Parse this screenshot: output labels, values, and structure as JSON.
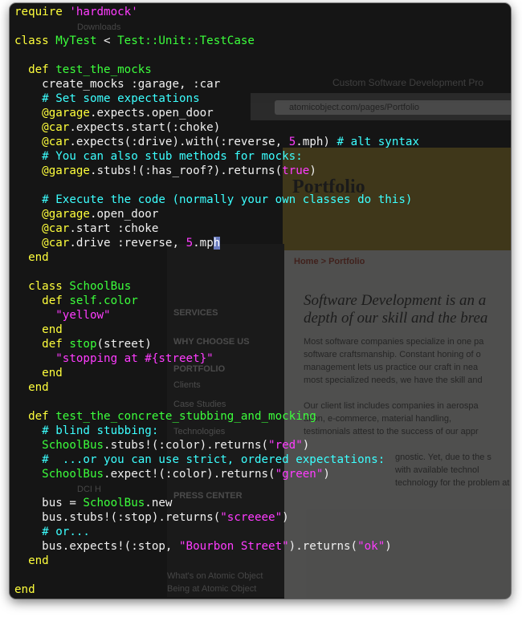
{
  "background_window": {
    "title": "Custom Software Development Pro",
    "url": "atomicobject.com/pages/Portfolio",
    "page_heading": "Portfolio",
    "breadcrumb": "Home > Portfolio",
    "tagline_1": "Software Development is an a",
    "tagline_2": "depth of our skill and the brea",
    "nav": [
      "SERVICES",
      "WHY CHOOSE US",
      "PORTFOLIO",
      "Clients",
      "Case Studies",
      "Technologies",
      "PRESS CENTER"
    ],
    "paragraph_1": [
      "Most software companies specialize in one pa",
      "software craftsmanship. Constant honing of o",
      "management lets us practice our craft in nea",
      "most specialized needs, we have the skill and"
    ],
    "paragraph_2": [
      "Our client list includes companies in aerospa",
      "ation, e-commerce, material handling,",
      "testimonials attest to the success of our appr"
    ],
    "paragraph_3": [
      "gnostic. Yet, due to the s",
      "with available technol",
      "technology for the problem at hand"
    ],
    "side_items": [
      "Downloads",
      "DCI H",
      "What's on Atomic Object",
      "Being at Atomic Object"
    ]
  },
  "code_lines": [
    [
      [
        "kw",
        "require"
      ],
      [
        "plain",
        " "
      ],
      [
        "str",
        "'hardmock'"
      ]
    ],
    [],
    [
      [
        "kw",
        "class"
      ],
      [
        "plain",
        " "
      ],
      [
        "name",
        "MyTest"
      ],
      [
        "plain",
        " < "
      ],
      [
        "const",
        "Test::Unit::TestCase"
      ]
    ],
    [],
    [
      [
        "plain",
        "  "
      ],
      [
        "kw",
        "def"
      ],
      [
        "plain",
        " "
      ],
      [
        "name",
        "test_the_mocks"
      ]
    ],
    [
      [
        "plain",
        "    create_mocks :garage, :car"
      ]
    ],
    [
      [
        "plain",
        "    "
      ],
      [
        "com",
        "# Set some expectations"
      ]
    ],
    [
      [
        "plain",
        "    "
      ],
      [
        "ivar",
        "@garage"
      ],
      [
        "plain",
        ".expects.open_door"
      ]
    ],
    [
      [
        "plain",
        "    "
      ],
      [
        "ivar",
        "@car"
      ],
      [
        "plain",
        ".expects.start(:choke)"
      ]
    ],
    [
      [
        "plain",
        "    "
      ],
      [
        "ivar",
        "@car"
      ],
      [
        "plain",
        ".expects(:drive).with(:reverse, "
      ],
      [
        "num",
        "5"
      ],
      [
        "plain",
        ".mph) "
      ],
      [
        "com",
        "# alt syntax"
      ]
    ],
    [
      [
        "plain",
        "    "
      ],
      [
        "com",
        "# You can also stub methods for mocks:"
      ]
    ],
    [
      [
        "plain",
        "    "
      ],
      [
        "ivar",
        "@garage"
      ],
      [
        "plain",
        ".stubs!(:has_roof?).returns("
      ],
      [
        "str",
        "true"
      ],
      [
        "plain",
        ")"
      ]
    ],
    [],
    [
      [
        "plain",
        "    "
      ],
      [
        "com",
        "# Execute the code (normally your own classes do this)"
      ]
    ],
    [
      [
        "plain",
        "    "
      ],
      [
        "ivar",
        "@garage"
      ],
      [
        "plain",
        ".open_door"
      ]
    ],
    [
      [
        "plain",
        "    "
      ],
      [
        "ivar",
        "@car"
      ],
      [
        "plain",
        ".start :choke"
      ]
    ],
    [
      [
        "plain",
        "    "
      ],
      [
        "ivar",
        "@car"
      ],
      [
        "plain",
        ".drive :reverse, "
      ],
      [
        "num",
        "5"
      ],
      [
        "plain",
        ".mp"
      ],
      [
        "cursor",
        "h"
      ]
    ],
    [
      [
        "plain",
        "  "
      ],
      [
        "kw",
        "end"
      ]
    ],
    [],
    [
      [
        "plain",
        "  "
      ],
      [
        "kw",
        "class"
      ],
      [
        "plain",
        " "
      ],
      [
        "name",
        "SchoolBus"
      ]
    ],
    [
      [
        "plain",
        "    "
      ],
      [
        "kw",
        "def"
      ],
      [
        "plain",
        " "
      ],
      [
        "name",
        "self.color"
      ]
    ],
    [
      [
        "plain",
        "      "
      ],
      [
        "str",
        "\"yellow\""
      ]
    ],
    [
      [
        "plain",
        "    "
      ],
      [
        "kw",
        "end"
      ]
    ],
    [
      [
        "plain",
        "    "
      ],
      [
        "kw",
        "def"
      ],
      [
        "plain",
        " "
      ],
      [
        "name",
        "stop"
      ],
      [
        "plain",
        "(street)"
      ]
    ],
    [
      [
        "plain",
        "      "
      ],
      [
        "str",
        "\"stopping at #{street}\""
      ]
    ],
    [
      [
        "plain",
        "    "
      ],
      [
        "kw",
        "end"
      ]
    ],
    [
      [
        "plain",
        "  "
      ],
      [
        "kw",
        "end"
      ]
    ],
    [],
    [
      [
        "plain",
        "  "
      ],
      [
        "kw",
        "def"
      ],
      [
        "plain",
        " "
      ],
      [
        "name",
        "test_the_concrete_stubbing_and_mocking"
      ]
    ],
    [
      [
        "plain",
        "    "
      ],
      [
        "com",
        "# blind stubbing:"
      ]
    ],
    [
      [
        "plain",
        "    "
      ],
      [
        "const",
        "SchoolBus"
      ],
      [
        "plain",
        ".stubs!(:color).returns("
      ],
      [
        "str",
        "\"red\""
      ],
      [
        "plain",
        ")"
      ]
    ],
    [
      [
        "plain",
        "    "
      ],
      [
        "com",
        "#  ...or you can use strict, ordered expectations:"
      ]
    ],
    [
      [
        "plain",
        "    "
      ],
      [
        "const",
        "SchoolBus"
      ],
      [
        "plain",
        ".expect!(:color).returns("
      ],
      [
        "str",
        "\"green\""
      ],
      [
        "plain",
        ")"
      ]
    ],
    [],
    [
      [
        "plain",
        "    bus = "
      ],
      [
        "const",
        "SchoolBus"
      ],
      [
        "plain",
        ".new"
      ]
    ],
    [
      [
        "plain",
        "    bus.stubs!(:stop).returns("
      ],
      [
        "str",
        "\"screeee\""
      ],
      [
        "plain",
        ")"
      ]
    ],
    [
      [
        "plain",
        "    "
      ],
      [
        "com",
        "# or..."
      ]
    ],
    [
      [
        "plain",
        "    bus.expects!(:stop, "
      ],
      [
        "str",
        "\"Bourbon Street\""
      ],
      [
        "plain",
        ").returns("
      ],
      [
        "str",
        "\"ok\""
      ],
      [
        "plain",
        ")"
      ]
    ],
    [
      [
        "plain",
        "  "
      ],
      [
        "kw",
        "end"
      ]
    ],
    [],
    [
      [
        "kw",
        "end"
      ]
    ]
  ]
}
